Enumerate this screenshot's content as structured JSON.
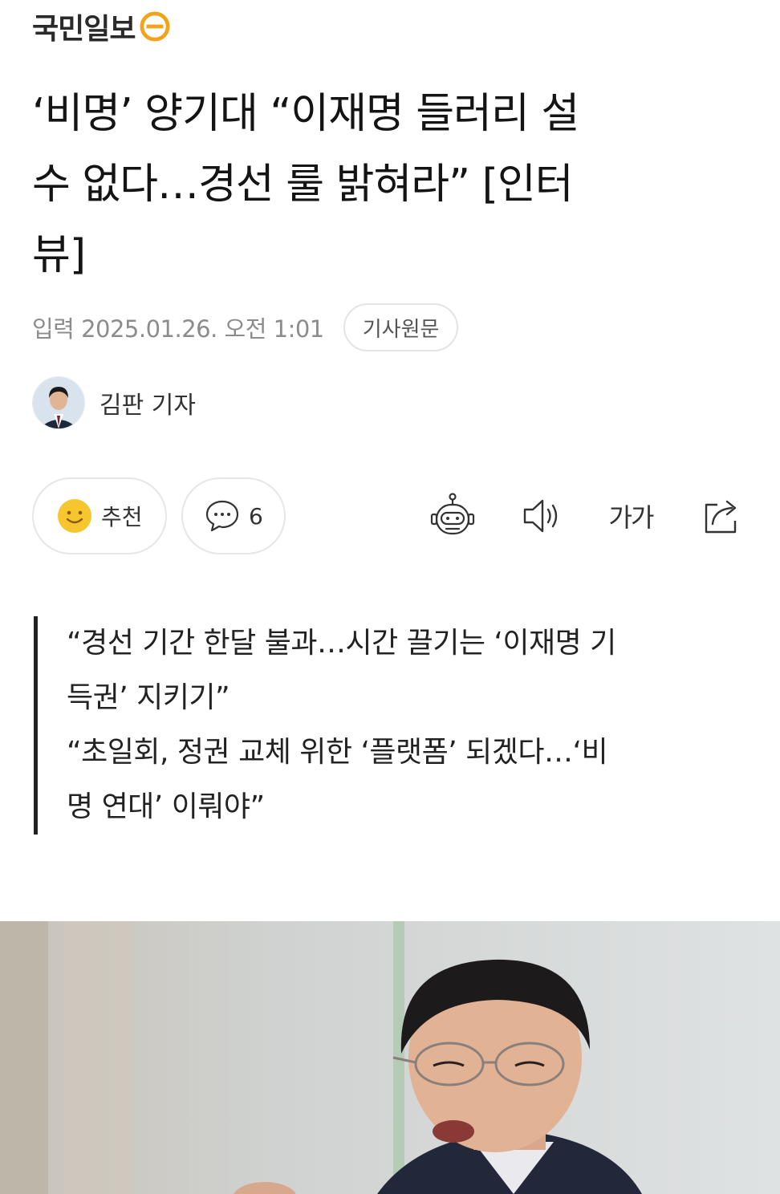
{
  "header": {
    "logo_text": "국민일보"
  },
  "article": {
    "headline_lines": [
      "‘비명’ 양기대 “이재명 들러리 설",
      "수 없다…경선 룰 밝혀라” [인터",
      "뷰]"
    ],
    "timestamp": "입력 2025.01.26. 오전 1:01",
    "original_button": "기사원문",
    "author": "김판 기자"
  },
  "actions": {
    "like_label": "추천",
    "comment_count": "6",
    "font_size_label": "가가"
  },
  "icons": {
    "like": "smiley-icon",
    "comment": "speech-bubble-icon",
    "summary": "robot-icon",
    "listen": "speaker-icon",
    "font": "font-size-icon",
    "share": "share-icon"
  },
  "summary_quotes": [
    "“경선 기간 한달 불과…시간 끌기는 ‘이재명 기",
    "득권’ 지키기”",
    "“초일회, 정권 교체 위한 ‘플랫폼’ 되겠다…‘비",
    "명 연대’ 이뤄야”"
  ],
  "colors": {
    "logo_accent": "#f3a31b",
    "smiley": "#f7c52e"
  }
}
